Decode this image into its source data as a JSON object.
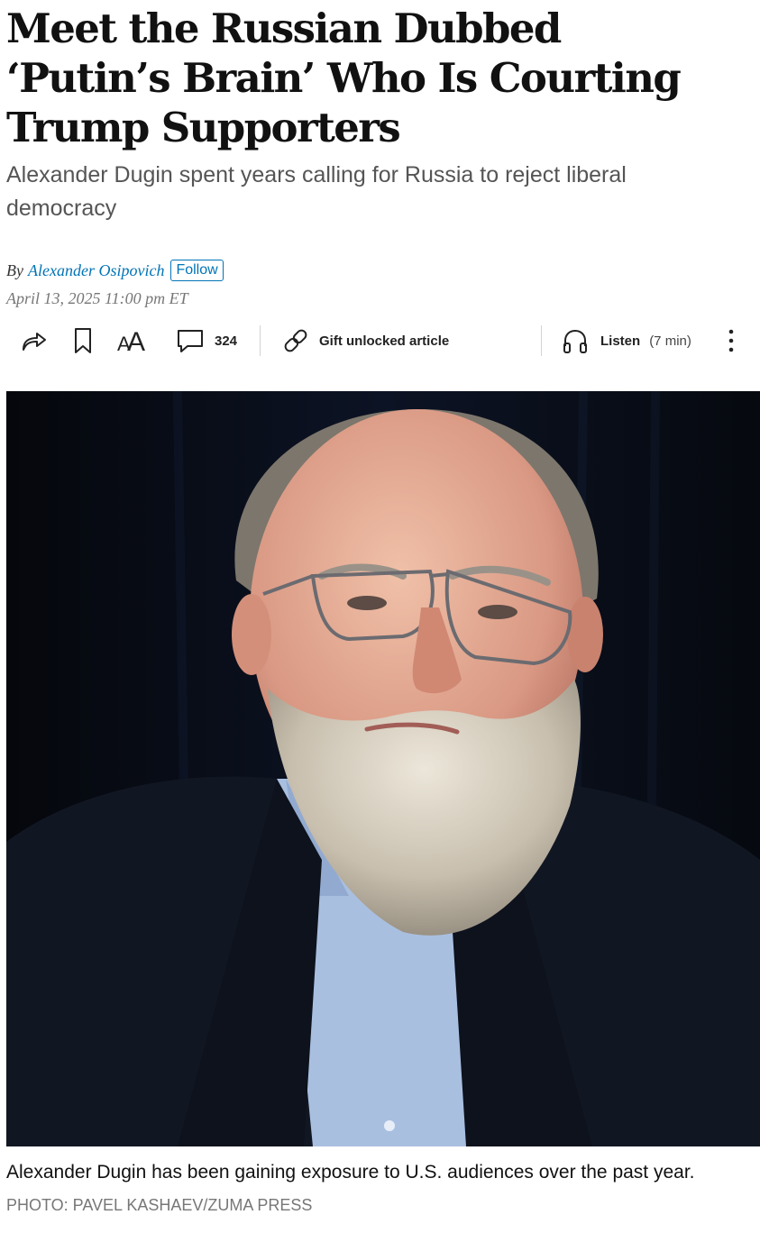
{
  "article": {
    "headline": "Meet the Russian Dubbed ‘Putin’s Brain’ Who Is Courting Trump Supporters",
    "dek": "Alexander Dugin spent years calling for Russia to reject liberal democracy",
    "byline_prefix": "By",
    "author": "Alexander Osipovich",
    "follow_label": "Follow",
    "timestamp": "April 13, 2025 11:00 pm ET"
  },
  "toolbar": {
    "share_icon": "share-arrow-icon",
    "bookmark_icon": "bookmark-icon",
    "text_size_label": "AA",
    "comments_icon": "comment-bubble-icon",
    "comments_count": "324",
    "gift_icon": "link-icon",
    "gift_label": "Gift unlocked article",
    "listen_icon": "headphones-icon",
    "listen_label": "Listen",
    "listen_duration": "(7 min)",
    "more_icon": "vertical-ellipsis-icon"
  },
  "media": {
    "caption": "Alexander Dugin has been gaining exposure to U.S. audiences over the past year.",
    "credit": "PHOTO: PAVEL KASHAEV/ZUMA PRESS"
  },
  "colors": {
    "link": "#0274b6",
    "dek": "#555555",
    "meta": "#777777",
    "text": "#111111"
  }
}
